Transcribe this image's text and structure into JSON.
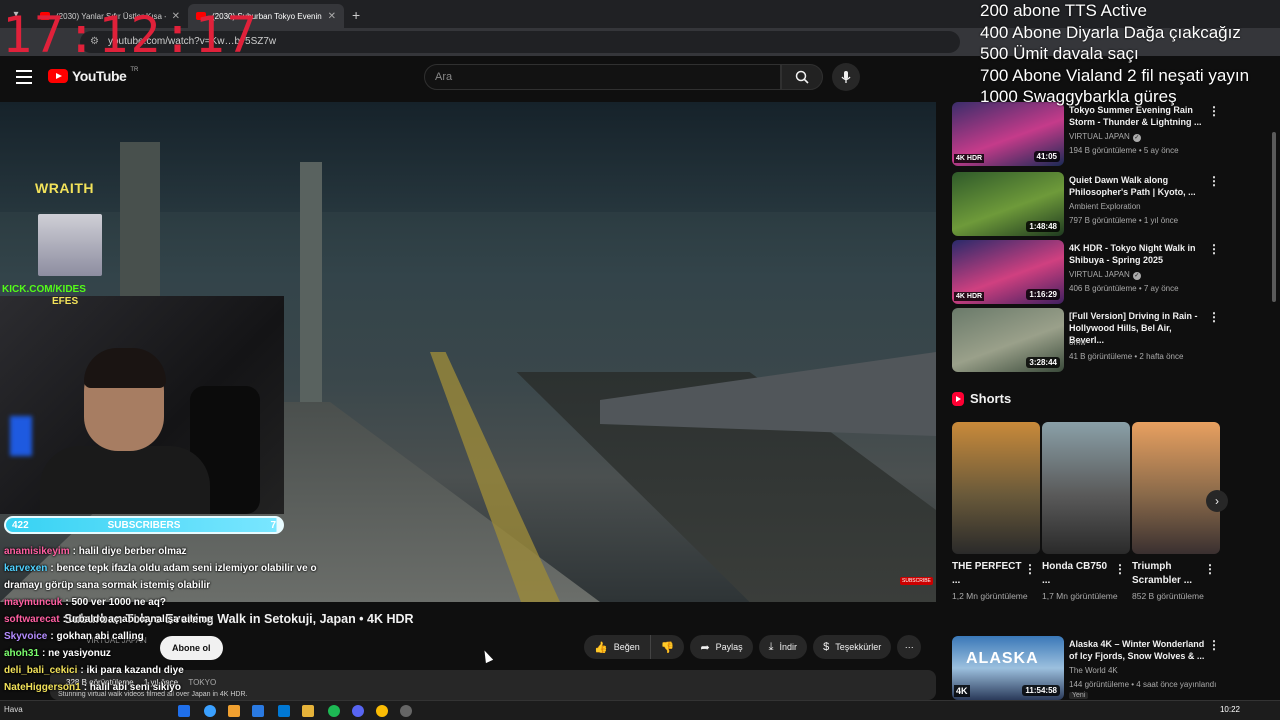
{
  "browser": {
    "tabs": [
      {
        "label": "(2030) Yanlar Sıfır Üstler Kısa - ",
        "active": false
      },
      {
        "label": "(2030) Suburban Tokyo Evening",
        "active": true
      }
    ],
    "url": "youtube.com/watch?v=Kw…by5SZ7w"
  },
  "overlay": {
    "clock": "17:12:17",
    "goals": [
      "200 abone TTS Active",
      "400 Abone Diyarla Dağa çıakcağız",
      "500 Ümit davala saçı",
      "700 Abone Vialand 2 fil neşati yayın",
      "1000 Swaggybarkla güreş"
    ],
    "wraith": "WRAITH",
    "kick": "KICK.COM/KIDES",
    "efes": "EFES",
    "subscribers": {
      "left": "422",
      "label": "SUBSCRIBERS",
      "right": "7",
      "progress": 0.98
    }
  },
  "youtube": {
    "logo": "YouTube",
    "logo_region": "TR",
    "search_placeholder": "Ara",
    "icons": {
      "menu": "hamburger-icon",
      "search": "search-icon",
      "mic": "mic-icon"
    }
  },
  "video": {
    "title": "Suburban Tokyo Evening Walk in Setokuji, Japan • 4K HDR",
    "channel": "VIRTUAL JAPAN",
    "channel_subs": "abone",
    "subscribe_label": "Abone ol",
    "actions": {
      "like": "Beğen",
      "share": "Paylaş",
      "download": "İndir",
      "thanks": "Teşekkürler"
    },
    "description": {
      "views": "328 B görüntüleme",
      "age": "1 yıl önce",
      "tag": "TOKYO",
      "line": "Stunning virtual walk videos filmed all over Japan in 4K HDR."
    },
    "watermark": "SUBSCRIBE"
  },
  "chat": [
    {
      "user": "anamisikeyim",
      "color": "#ff5fa2",
      "msg": ": halil diye berber olmaz"
    },
    {
      "user": "karvexen",
      "color": "#4fd1ff",
      "msg": ": bence tepk ifazla oldu adam seni izlemiyor olabilir ve o dramayı görüp sana sormak istemiş olabilir"
    },
    {
      "user": "maymuncuk",
      "color": "#ff5fa2",
      "msg": ": 500 ver 1000 ne aq?"
    },
    {
      "user": "softwarecat",
      "color": "#ff5fa2",
      "msg": ": urbaldo aç abi canalışa aileme"
    },
    {
      "user": "Skyvoice",
      "color": "#b48cff",
      "msg": ": gokhan abi calling"
    },
    {
      "user": "ahoh31",
      "color": "#7cff6e",
      "msg": ": ne yasiyonuz"
    },
    {
      "user": "deli_bali_cekici",
      "color": "#f2e25a",
      "msg": ": iki para kazandı diye"
    },
    {
      "user": "NateHiggerson1",
      "color": "#f2e25a",
      "msg": ": halil abi seni sikiyo"
    }
  ],
  "recommendations": [
    {
      "title": "Tokyo Summer Evening Rain Storm - Thunder & Lightning ...",
      "channel": "VIRTUAL JAPAN",
      "verified": true,
      "views": "194 B görüntüleme",
      "age": "5 ay önce",
      "duration": "41:05",
      "badge": "4K HDR",
      "colors": [
        "#3a2d6a",
        "#c53b8a",
        "#1a2a55"
      ]
    },
    {
      "title": "Quiet Dawn Walk along Philosopher's Path | Kyoto, ...",
      "channel": "Ambient Exploration",
      "verified": false,
      "views": "797 B görüntüleme",
      "age": "1 yıl önce",
      "duration": "1:48:48",
      "badge": "",
      "colors": [
        "#2f5a2a",
        "#6e9a3a",
        "#1f3a20"
      ]
    },
    {
      "title": "4K HDR - Tokyo Night Walk in Shibuya - Spring 2025",
      "channel": "VIRTUAL JAPAN",
      "verified": true,
      "views": "406 B görüntüleme",
      "age": "7 ay önce",
      "duration": "1:16:29",
      "badge": "4K HDR",
      "colors": [
        "#2a2a6a",
        "#d04080",
        "#402060"
      ]
    },
    {
      "title": "[Full Version] Driving in Rain - Hollywood Hills, Bel Air, Beverl...",
      "channel": "omw",
      "verified": false,
      "views": "41 B görüntüleme",
      "age": "2 hafta önce",
      "duration": "3:28:44",
      "badge": "",
      "colors": [
        "#6a7a6a",
        "#9aa08a",
        "#3a4a3a"
      ]
    }
  ],
  "shorts": {
    "heading": "Shorts",
    "items": [
      {
        "title": "THE PERFECT ...",
        "views": "1,2 Mn görüntüleme",
        "colors": [
          "#c98a3a",
          "#6a5a3a",
          "#2a2a2a"
        ]
      },
      {
        "title": "Honda CB750 ...",
        "views": "1,7 Mn görüntüleme",
        "colors": [
          "#8aa0a8",
          "#5a5a5a",
          "#2a2a2a"
        ]
      },
      {
        "title": "Triumph Scrambler ...",
        "views": "852 B görüntüleme",
        "colors": [
          "#e8a060",
          "#8a6a4a",
          "#3a3030"
        ]
      }
    ]
  },
  "bottom_rec": {
    "title": "Alaska 4K – Winter Wonderland of Icy Fjords, Snow Wolves & ...",
    "channel": "The World 4K",
    "views": "144 görüntüleme",
    "age": "4 saat önce yayınlandı",
    "duration": "11:54:58",
    "new_badge": "Yeni",
    "thumb_text": "ALASKA",
    "badge": "4K"
  },
  "taskbar": {
    "time": "10:22",
    "weather": "Hava"
  }
}
